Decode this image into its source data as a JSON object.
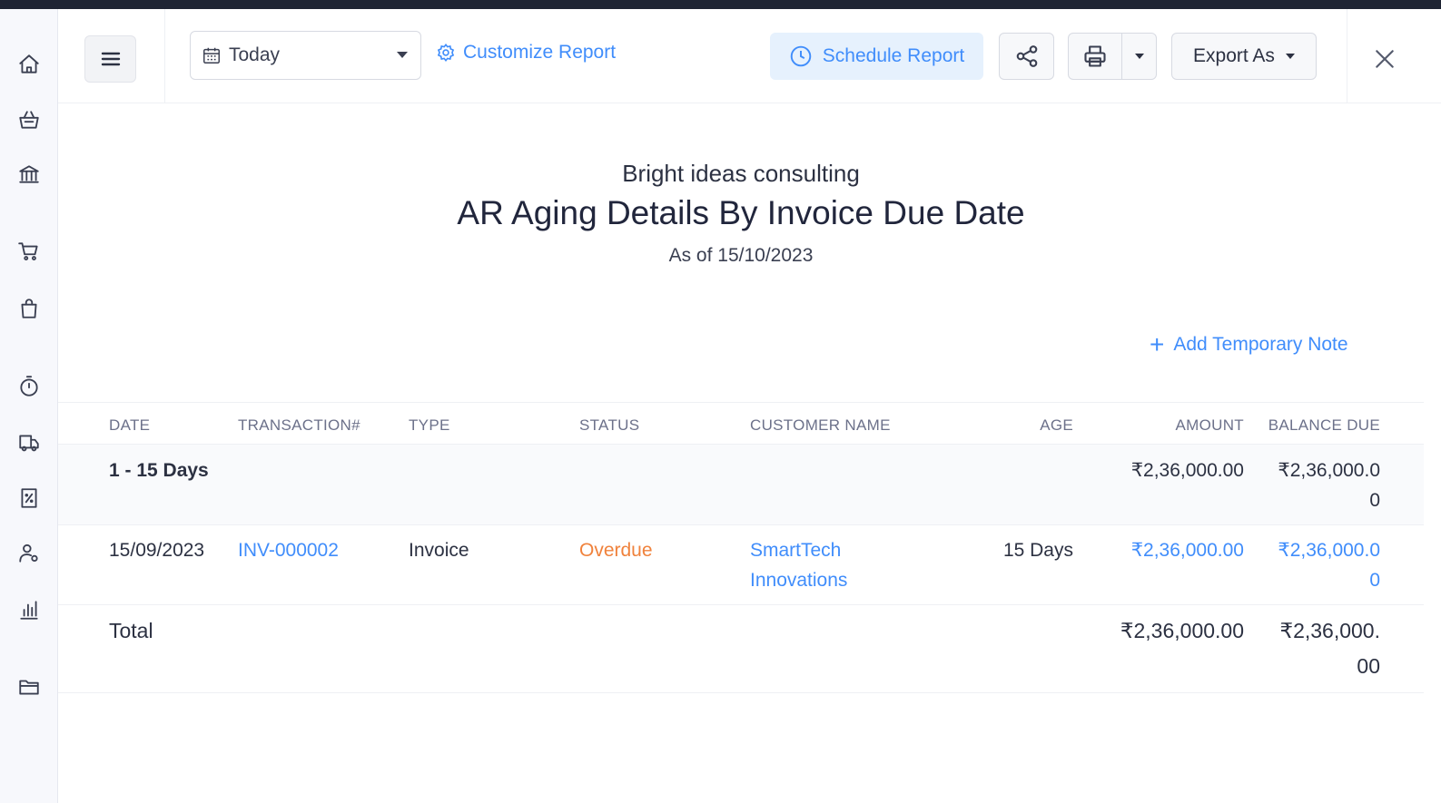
{
  "toolbar": {
    "date_range": "Today",
    "customize_label": "Customize Report",
    "schedule_label": "Schedule Report",
    "export_label": "Export As"
  },
  "report": {
    "organization": "Bright ideas consulting",
    "title": "AR Aging Details By Invoice Due Date",
    "as_of": "As of 15/10/2023",
    "add_note_label": "Add Temporary Note"
  },
  "table": {
    "headers": [
      "DATE",
      "TRANSACTION#",
      "TYPE",
      "STATUS",
      "CUSTOMER NAME",
      "AGE",
      "AMOUNT",
      "BALANCE DUE"
    ],
    "group": {
      "label": "1 - 15 Days",
      "amount": "₹2,36,000.00",
      "balance_line1": "₹2,36,000.0",
      "balance_line2": "0"
    },
    "rows": [
      {
        "date": "15/09/2023",
        "transaction": "INV-000002",
        "type": "Invoice",
        "status": "Overdue",
        "customer_line1": "SmartTech",
        "customer_line2": "Innovations",
        "age": "15 Days",
        "amount": "₹2,36,000.00",
        "balance_line1": "₹2,36,000.0",
        "balance_line2": "0"
      }
    ],
    "total": {
      "label": "Total",
      "amount": "₹2,36,000.00",
      "balance_line1": "₹2,36,000.",
      "balance_line2": "00"
    }
  },
  "colors": {
    "accent": "#408dfb",
    "overdue": "#f0823c",
    "topbar": "#1f2433"
  },
  "icons": {
    "sidebar": [
      "home-icon",
      "basket-icon",
      "bank-icon",
      "cart-icon",
      "shopping-bag-icon",
      "timer-icon",
      "truck-icon",
      "percent-doc-icon",
      "accountant-icon",
      "bar-chart-icon",
      "folder-icon"
    ]
  }
}
